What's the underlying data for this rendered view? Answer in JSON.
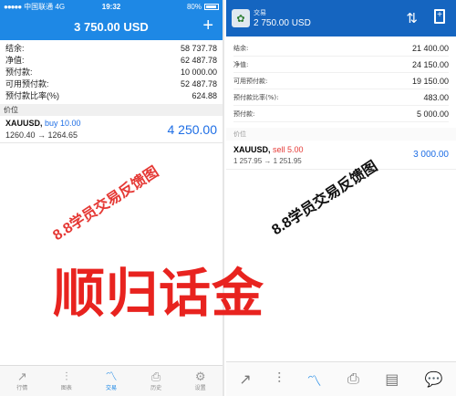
{
  "left": {
    "status": {
      "carrier": "中国联通 4G",
      "time": "19:32",
      "battery": "80%"
    },
    "header": {
      "title": "3 750.00 USD",
      "plus": "+"
    },
    "account": [
      {
        "label": "结余:",
        "value": "58 737.78"
      },
      {
        "label": "净值:",
        "value": "62 487.78"
      },
      {
        "label": "预付款:",
        "value": "10 000.00"
      },
      {
        "label": "可用预付款:",
        "value": "52 487.78"
      },
      {
        "label": "预付款比率(%)",
        "value": "624.88"
      }
    ],
    "section_label": "价位",
    "position": {
      "symbol": "XAUUSD,",
      "side": "buy 10.00",
      "prices": "1260.40 → 1264.65",
      "profit": "4 250.00"
    },
    "tabs": [
      {
        "icon": "↗",
        "label": "行情"
      },
      {
        "icon": "⫶",
        "label": "图表"
      },
      {
        "icon": "〽",
        "label": "交易"
      },
      {
        "icon": "⎙",
        "label": "历史"
      },
      {
        "icon": "⚙",
        "label": "设置"
      }
    ]
  },
  "right": {
    "header": {
      "subtitle": "交易",
      "title": "2 750.00 USD"
    },
    "account": [
      {
        "label": "结余:",
        "value": "21 400.00"
      },
      {
        "label": "净值:",
        "value": "24 150.00"
      },
      {
        "label": "可用预付款:",
        "value": "19 150.00"
      },
      {
        "label": "预付款比率(%):",
        "value": "483.00"
      },
      {
        "label": "预付款:",
        "value": "5 000.00"
      }
    ],
    "section_label": "价位",
    "position": {
      "symbol": "XAUUSD,",
      "side": "sell 5.00",
      "prices": "1 257.95 → 1 251.95",
      "profit": "3 000.00"
    }
  },
  "overlays": {
    "left_tilt": "8.8学员交易反馈图",
    "right_tilt": "8.8学员交易反馈图",
    "big": "顺归话金"
  },
  "colors": {
    "ios_blue": "#1e88e5",
    "android_blue": "#1565c0",
    "overlay_red": "#e53935"
  }
}
